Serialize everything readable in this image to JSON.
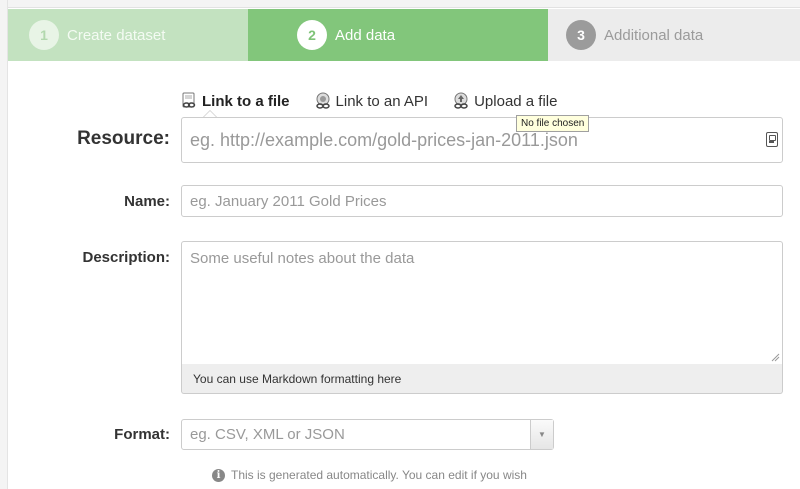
{
  "stages": [
    {
      "number": "1",
      "label": "Create dataset",
      "state": "complete"
    },
    {
      "number": "2",
      "label": "Add data",
      "state": "active"
    },
    {
      "number": "3",
      "label": "Additional data",
      "state": "upcoming"
    }
  ],
  "resource_tabs": [
    {
      "label": "Link to a file",
      "icon": "link-icon",
      "active": true
    },
    {
      "label": "Link to an API",
      "icon": "api-icon",
      "active": false
    },
    {
      "label": "Upload a file",
      "icon": "upload-icon",
      "active": false
    }
  ],
  "tooltip": "No file chosen",
  "form": {
    "resource": {
      "label": "Resource:",
      "placeholder": "eg. http://example.com/gold-prices-jan-2011.json"
    },
    "name": {
      "label": "Name:",
      "placeholder": "eg. January 2011 Gold Prices"
    },
    "description": {
      "label": "Description:",
      "placeholder": "Some useful notes about the data",
      "footer": "You can use Markdown formatting here"
    },
    "format": {
      "label": "Format:",
      "placeholder": "eg. CSV, XML or JSON",
      "help": "This is generated automatically. You can edit if you wish"
    }
  },
  "colors": {
    "stage_complete": "#c3e2c0",
    "stage_active": "#82c67b",
    "stage_upcoming": "#ececec"
  }
}
